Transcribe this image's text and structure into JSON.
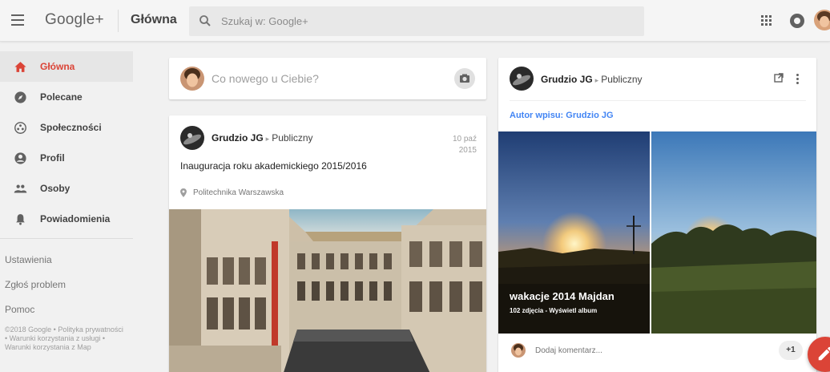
{
  "app": {
    "logo": "Google+",
    "page_title": "Główna"
  },
  "search": {
    "placeholder": "Szukaj w: Google+"
  },
  "colors": {
    "accent": "#db4437",
    "link": "#4285f4"
  },
  "sidebar": {
    "items": [
      {
        "label": "Główna",
        "icon": "home-icon",
        "active": true
      },
      {
        "label": "Polecane",
        "icon": "compass-icon",
        "active": false
      },
      {
        "label": "Społeczności",
        "icon": "communities-icon",
        "active": false
      },
      {
        "label": "Profil",
        "icon": "profile-icon",
        "active": false
      },
      {
        "label": "Osoby",
        "icon": "people-icon",
        "active": false
      },
      {
        "label": "Powiadomienia",
        "icon": "bell-icon",
        "active": false
      }
    ],
    "links": [
      "Ustawienia",
      "Zgłoś problem",
      "Pomoc"
    ],
    "footer": "©2018 Google • Polityka prywatności • Warunki korzystania z usługi • Warunki korzystania z Map"
  },
  "composer": {
    "prompt": "Co nowego u Ciebie?",
    "icon": "camera-icon"
  },
  "post1": {
    "author": "Grudzio JG",
    "visibility": "Publiczny",
    "date_line1": "10 paź",
    "date_line2": "2015",
    "text": "Inauguracja roku akademickiego 2015/2016",
    "location": "Politechnika Warszawska"
  },
  "post2": {
    "author": "Grudzio JG",
    "visibility": "Publiczny",
    "author_label": "Autor wpisu: Grudzio JG",
    "album_title": "wakacje 2014 Majdan",
    "album_subtitle": "102 zdjęcia - Wyświetl album",
    "comment_placeholder": "Dodaj komentarz...",
    "plus_one": "+1"
  }
}
